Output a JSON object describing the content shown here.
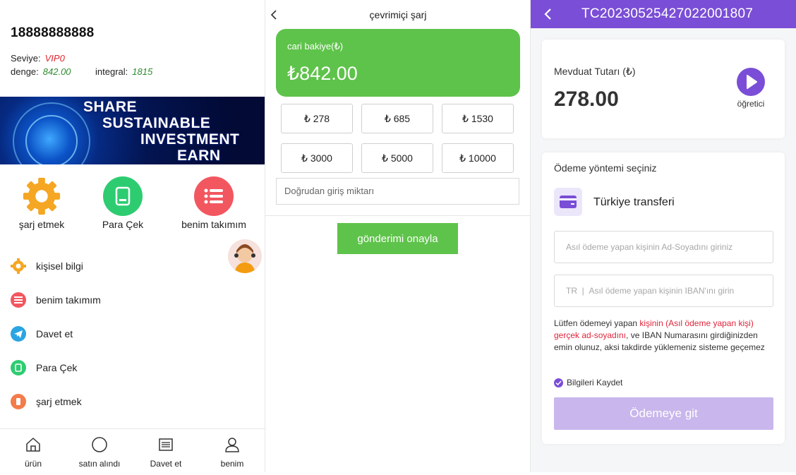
{
  "profile": {
    "phone": "18888888888",
    "level_label": "Seviye:",
    "level_value": "VIP0",
    "balance_label": "denge:",
    "balance_value": "842.00",
    "integral_label": "integral:",
    "integral_value": "1815"
  },
  "banner": {
    "lines": [
      "SHARE",
      "SUSTAINABLE",
      "INVESTMENT",
      "EARN"
    ]
  },
  "quick_actions": [
    {
      "label": "şarj etmek",
      "icon": "gear-icon",
      "color": "#f5a623"
    },
    {
      "label": "Para Çek",
      "icon": "wallet-icon",
      "color": "#2ecc71"
    },
    {
      "label": "benim takımım",
      "icon": "list-icon",
      "color": "#f25760"
    }
  ],
  "menu": [
    {
      "label": "kişisel bilgi",
      "icon": "gear-icon",
      "color": "#f5a623"
    },
    {
      "label": "benim takımım",
      "icon": "list-icon",
      "color": "#f25760"
    },
    {
      "label": "Davet et",
      "icon": "telegram-icon",
      "color": "#2aa4e3"
    },
    {
      "label": "Para Çek",
      "icon": "wallet-icon",
      "color": "#2ecc71"
    },
    {
      "label": "şarj etmek",
      "icon": "charge-icon",
      "color": "#f47b4a"
    }
  ],
  "tabbar": [
    {
      "label": "ürün",
      "icon": "home-icon"
    },
    {
      "label": "satın alındı",
      "icon": "circle-icon"
    },
    {
      "label": "Davet et",
      "icon": "list-icon"
    },
    {
      "label": "benim",
      "icon": "user-icon"
    }
  ],
  "recharge": {
    "title": "çevrimiçi şarj",
    "card_label": "cari bakiye(₺)",
    "card_value": "₺842.00",
    "amounts": [
      "₺ 278",
      "₺ 685",
      "₺ 1530",
      "₺ 3000",
      "₺ 5000",
      "₺ 10000"
    ],
    "input_placeholder": "Doğrudan giriş miktarı",
    "confirm_label": "gönderimi onayla",
    "accent": "#5ec34a"
  },
  "payment": {
    "order_id": "TC20230525427022001807",
    "deposit_label": "Mevduat Tutarı (₺)",
    "deposit_value": "278.00",
    "tutorial_label": "öğretici",
    "method_label": "Ödeme yöntemi seçiniz",
    "method_name": "Türkiye transferi",
    "name_placeholder": "Asıl ödeme yapan kişinin Ad-Soyadını giriniz",
    "iban_prefix": "TR",
    "iban_placeholder": "Asıl ödeme yapan kişinin IBAN'ını girin",
    "note_part1": "Lütfen ödemeyi yapan ",
    "note_highlight": "kişinin (Asıl ödeme yapan kişi) gerçek ad-soyadını",
    "note_part2": ", ve IBAN Numarasını girdiğinizden emin olunuz, aksi takdirde yüklemeniz sisteme geçemez",
    "save_label": "Bilgileri Kaydet",
    "go_label": "Ödemeye git",
    "accent": "#7a4ed6"
  }
}
